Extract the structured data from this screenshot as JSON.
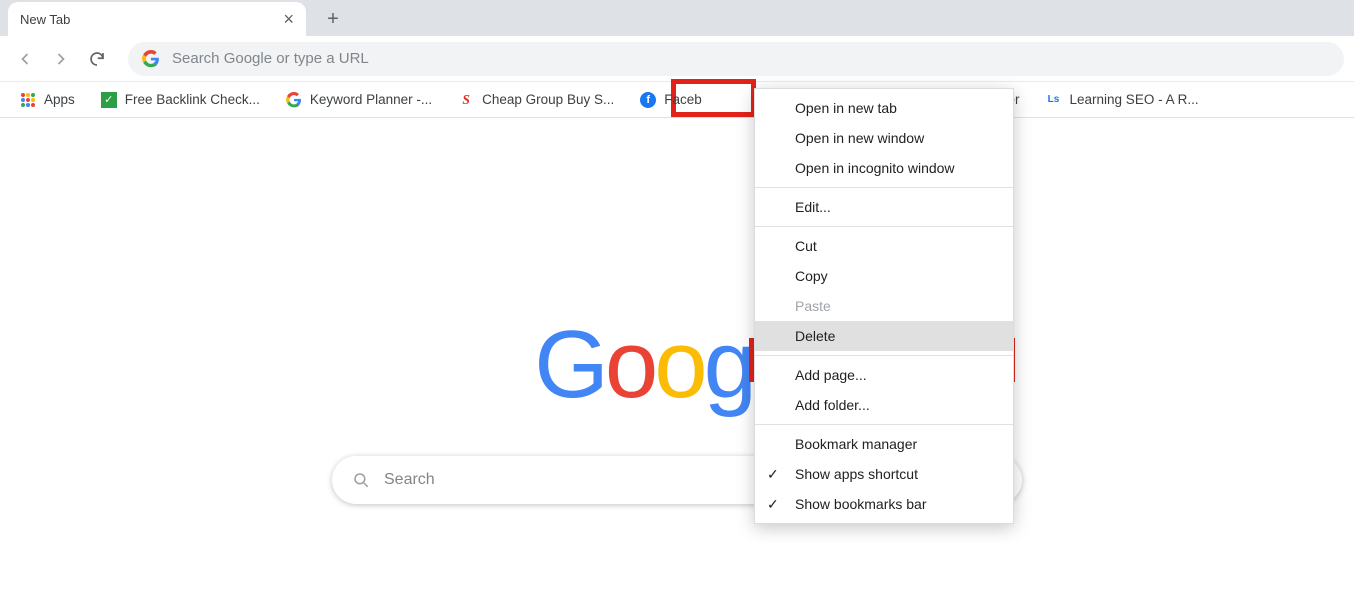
{
  "tab": {
    "title": "New Tab"
  },
  "omnibox": {
    "placeholder": "Search Google or type a URL"
  },
  "bookmarks": {
    "apps": "Apps",
    "items": [
      {
        "label": "Free Backlink Check...",
        "icon": "check-green"
      },
      {
        "label": "Keyword Planner -...",
        "icon": "google-g"
      },
      {
        "label": "Cheap Group Buy S...",
        "icon": "red-s"
      },
      {
        "label": "Faceb",
        "icon": "facebook"
      },
      {
        "label": "ter",
        "icon": ""
      },
      {
        "label": "Learning SEO - A R...",
        "icon": "blue-ls"
      }
    ]
  },
  "context_menu": {
    "open_tab": "Open in new tab",
    "open_window": "Open in new window",
    "open_incognito": "Open in incognito window",
    "edit": "Edit...",
    "cut": "Cut",
    "copy": "Copy",
    "paste": "Paste",
    "delete": "Delete",
    "add_page": "Add page...",
    "add_folder": "Add folder...",
    "bookmark_manager": "Bookmark manager",
    "show_apps": "Show apps shortcut",
    "show_bookmarks": "Show bookmarks bar"
  },
  "ntp": {
    "search_placeholder": "Search "
  }
}
